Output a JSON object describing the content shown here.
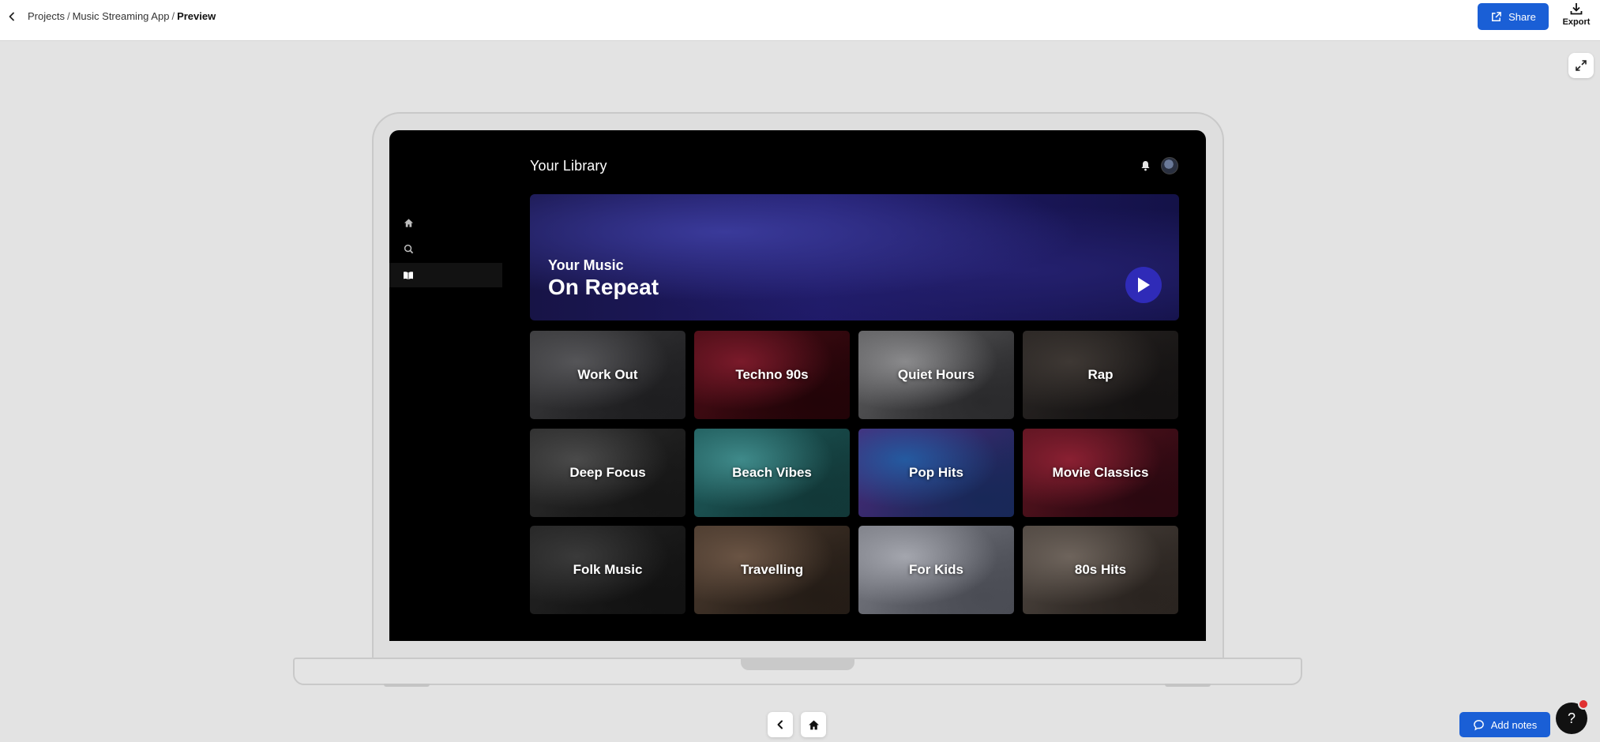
{
  "topbar": {
    "breadcrumb": [
      {
        "label": "Projects"
      },
      {
        "label": "Music Streaming App"
      },
      {
        "label": "Preview"
      }
    ],
    "separator": "/",
    "share_label": "Share",
    "export_label": "Export"
  },
  "app": {
    "library_title": "Your Library",
    "hero": {
      "subtitle": "Your Music",
      "title": "On Repeat"
    },
    "tiles": [
      {
        "label": "Work Out",
        "colors": [
          "#3a3a3c",
          "#555558",
          "#1e1e20"
        ]
      },
      {
        "label": "Techno 90s",
        "colors": [
          "#4a0d16",
          "#7a1a2a",
          "#220408"
        ]
      },
      {
        "label": "Quiet Hours",
        "colors": [
          "#5e5e60",
          "#8a8a8c",
          "#2a2a2c"
        ]
      },
      {
        "label": "Rap",
        "colors": [
          "#2a2624",
          "#3e3834",
          "#141212"
        ]
      },
      {
        "label": "Deep Focus",
        "colors": [
          "#2c2c2c",
          "#4a4a4a",
          "#161616"
        ]
      },
      {
        "label": "Beach Vibes",
        "colors": [
          "#1e5a5a",
          "#3f8a8a",
          "#123838"
        ]
      },
      {
        "label": "Pop Hits",
        "colors": [
          "#4a2a78",
          "#245aa0",
          "#182858"
        ]
      },
      {
        "label": "Movie Classics",
        "colors": [
          "#5a1420",
          "#8a2032",
          "#2a0810"
        ]
      },
      {
        "label": "Folk Music",
        "colors": [
          "#242424",
          "#3a3a3a",
          "#121212"
        ]
      },
      {
        "label": "Travelling",
        "colors": [
          "#4a3a2e",
          "#6a5444",
          "#241c16"
        ]
      },
      {
        "label": "For Kids",
        "colors": [
          "#7a7c84",
          "#a4a6ae",
          "#4a4c54"
        ]
      },
      {
        "label": "80s Hits",
        "colors": [
          "#4e4640",
          "#6e645c",
          "#2a2420"
        ]
      }
    ]
  },
  "controls": {
    "add_notes_label": "Add notes",
    "help_label": "?"
  },
  "colors": {
    "accent": "#1a5fd6",
    "hero_play": "#2f2bb8"
  }
}
